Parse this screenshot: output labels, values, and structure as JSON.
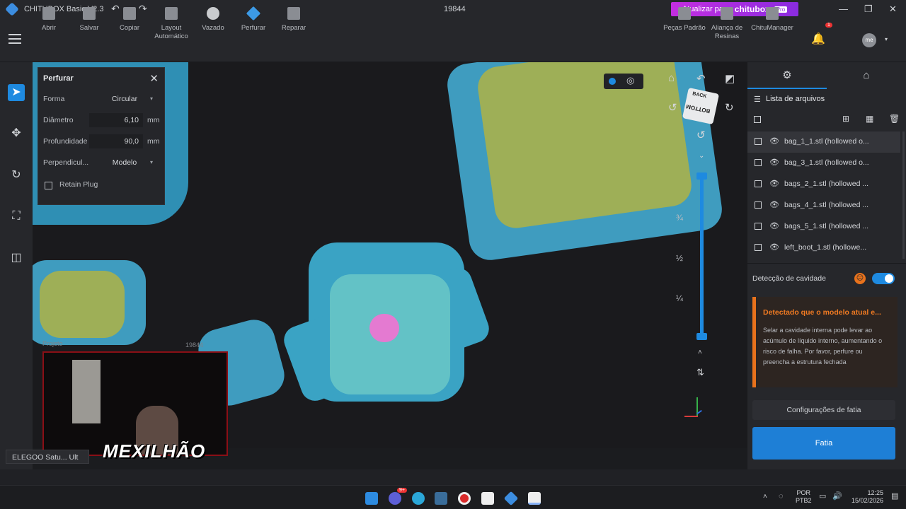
{
  "titlebar": {
    "app_title": "CHITUBOX Basic V2.3",
    "doc_title": "19844",
    "upgrade_label": "Atualizar para",
    "upgrade_brand": "chitubox",
    "upgrade_tag": "Pro"
  },
  "toolbar": {
    "open": "Abrir",
    "save": "Salvar",
    "copy": "Copiar",
    "layout_line1": "Layout",
    "layout_line2": "Automático",
    "hollow": "Vazado",
    "punch": "Perfurar",
    "repair": "Reparar",
    "parts_line1": "Peças Padrão",
    "resin_line1": "Aliança de",
    "resin_line2": "Resinas",
    "chitumanager": "ChituManager",
    "notif_count": "1",
    "avatar": "me"
  },
  "punch_panel": {
    "title": "Perfurar",
    "shape_label": "Forma",
    "shape_value": "Circular",
    "diameter_label": "Diâmetro",
    "diameter_value": "6,10",
    "depth_label": "Profundidade",
    "depth_value": "90,0",
    "unit": "mm",
    "perp_label": "Perpendicul...",
    "perp_value": "Modelo",
    "retain_plug": "Retain Plug"
  },
  "viewport": {
    "cube_top": "BACK",
    "cube_front": "BOTTOM",
    "frac_3_4": "¾",
    "frac_1_2": "½",
    "frac_1_4": "¼",
    "wm_project": "Projeto",
    "wm_id": "19844",
    "printer": "ELEGOO Satu... Ult"
  },
  "files": {
    "header": "Lista de arquivos",
    "items": [
      {
        "name": "bag_1_1.stl (hollowed o..."
      },
      {
        "name": "bag_3_1.stl (hollowed o..."
      },
      {
        "name": "bags_2_1.stl (hollowed ..."
      },
      {
        "name": "bags_4_1.stl (hollowed ..."
      },
      {
        "name": "bags_5_1.stl (hollowed ..."
      },
      {
        "name": "left_boot_1.stl (hollowe..."
      }
    ]
  },
  "cavity": {
    "label": "Detecção de cavidade",
    "warn_title": "Detectado que o modelo atual e...",
    "warn_body": "Selar a cavidade interna pode levar ao acúmulo de líquido interno, aumentando o risco de falha. Por favor, perfure ou preencha a estrutura fechada"
  },
  "actions": {
    "slice_settings": "Configurações de fatia",
    "slice": "Fatia"
  },
  "webcam": {
    "overlay_text": "MEXILHÃO"
  },
  "taskbar": {
    "lang1": "POR",
    "lang2": "PTB2",
    "time": "12:25",
    "date": "15/02/2026",
    "badge": "9+"
  },
  "colors": {
    "accent": "#1e8ae0",
    "upgrade": "#b02ee0",
    "warning": "#f07a22",
    "model_cyan": "#3fa8c8",
    "model_yellow": "#a8b23a"
  }
}
